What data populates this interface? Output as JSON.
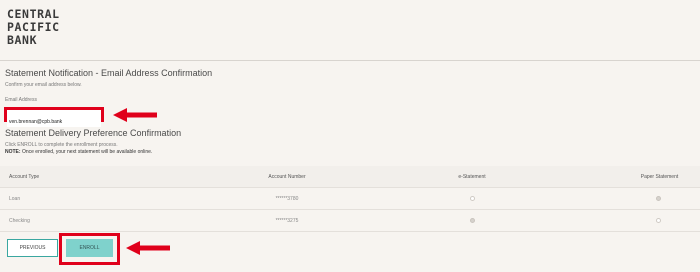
{
  "brand": {
    "logo_lines": [
      "CENTRAL",
      "PACIFIC",
      "BANK"
    ]
  },
  "email_section": {
    "title": "Statement Notification - Email Address Confirmation",
    "subtitle": "Confirm your email address below.",
    "field_label": "Email Address",
    "email_value": "ven.brennan@cpb.bank"
  },
  "delivery_section": {
    "title": "Statement Delivery Preference Confirmation",
    "instruction": "Click ENROLL to complete the enrollment process.",
    "note_prefix": "NOTE:",
    "note_text": " Once enrolled, your next statement will be available online."
  },
  "table": {
    "headers": [
      "Account Type",
      "Account Number",
      "e-Statement",
      "Paper Statement"
    ],
    "rows": [
      {
        "type": "Loan",
        "number": "******3780",
        "e_statement_selected": false,
        "paper_statement_selected": true
      },
      {
        "type": "Checking",
        "number": "******3275",
        "e_statement_selected": true,
        "paper_statement_selected": false
      }
    ]
  },
  "buttons": {
    "previous": "PREVIOUS",
    "enroll": "ENROLL"
  },
  "colors": {
    "highlight": "#e0001b",
    "accent": "#7fd2cc",
    "background": "#f7f4f0"
  },
  "annotations": [
    "red-arrow-left",
    "red-arrow-left"
  ]
}
